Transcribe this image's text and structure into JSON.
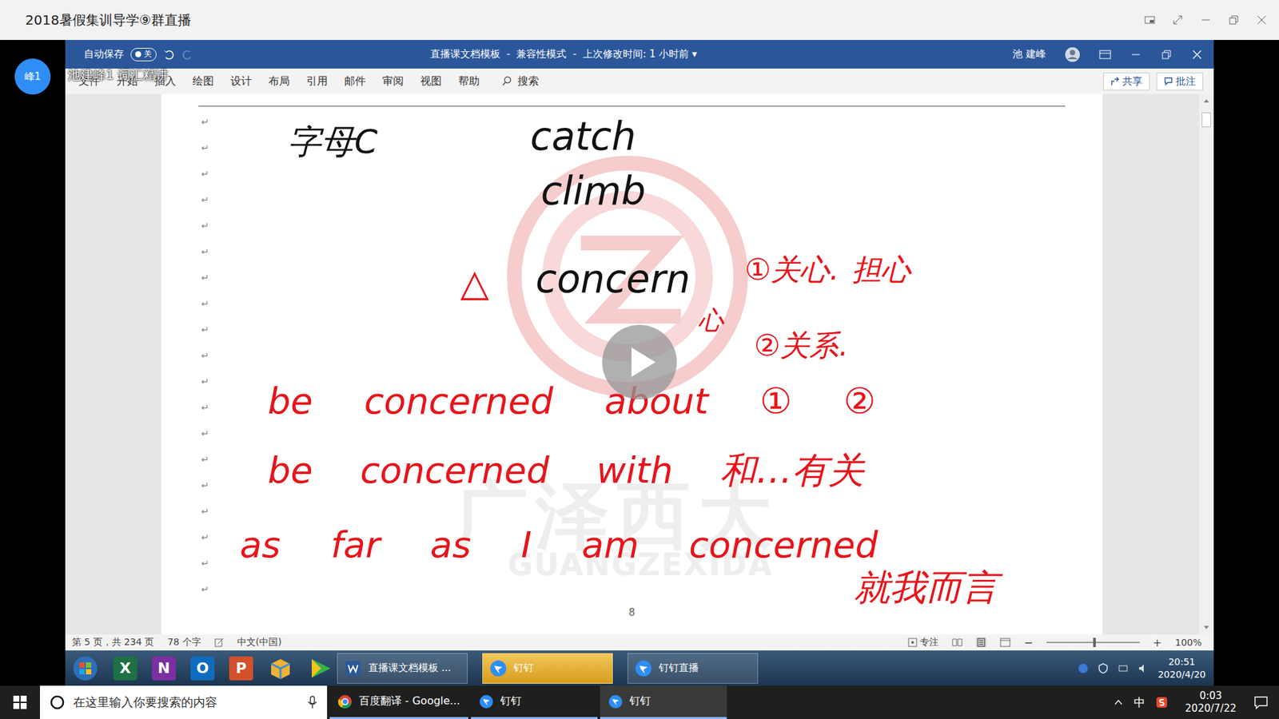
{
  "window": {
    "title": "2018暑假集训导学⑨群直播"
  },
  "presenter": {
    "avatar": "峰1",
    "caption": "池建峰1 词汇精讲"
  },
  "word": {
    "autosave": {
      "label": "自动保存",
      "state": "关",
      "on": false
    },
    "title": "直播课文档模板  -  兼容性模式  -  上次修改时间: 1 小时前 ▾",
    "user": "池 建峰",
    "tabs": [
      {
        "label": "文件",
        "selected": false
      },
      {
        "label": "开始",
        "selected": false
      },
      {
        "label": "插入",
        "selected": false
      },
      {
        "label": "绘图",
        "selected": false
      },
      {
        "label": "设计",
        "selected": false
      },
      {
        "label": "布局",
        "selected": false
      },
      {
        "label": "引用",
        "selected": false
      },
      {
        "label": "邮件",
        "selected": false
      },
      {
        "label": "审阅",
        "selected": false
      },
      {
        "label": "视图",
        "selected": false
      },
      {
        "label": "帮助",
        "selected": false
      }
    ],
    "search": "搜索",
    "share": "共享",
    "comment": "批注"
  },
  "document": {
    "paragraph_marks": [
      "↵",
      "↵",
      "↵",
      "↵",
      "↵",
      "↵",
      "↵",
      "↵",
      "↵",
      "↵",
      "↵",
      "↵",
      "↵",
      "↵",
      "↵",
      "↵",
      "↵",
      "↵",
      "↵"
    ],
    "handwriting": [
      {
        "text": "字母C",
        "color": "#111111"
      },
      {
        "text": "catch",
        "color": "#111111"
      },
      {
        "text": "climb",
        "color": "#111111"
      },
      {
        "text": "△",
        "color": "#e8141b"
      },
      {
        "text": "concern",
        "color": "#111111"
      },
      {
        "text": "①关心. 担心",
        "color": "#e8141b"
      },
      {
        "text": "心",
        "color": "#e8141b"
      },
      {
        "text": "②关系.",
        "color": "#e8141b"
      },
      {
        "text": "be concerned about ① ②",
        "color": "#e8141b"
      },
      {
        "text": "be concerned with 和…有关",
        "color": "#e8141b"
      },
      {
        "text": "as far as I am concerned",
        "color": "#e8141b"
      },
      {
        "text": "就我而言",
        "color": "#e8141b"
      }
    ],
    "watermark": {
      "cn": "广泽西大",
      "en": "GUANGZEXIDA"
    },
    "page_number": "8"
  },
  "status_bar": {
    "page": "第 5 页，共 234 页",
    "words": "78 个字",
    "language": "中文(中国)",
    "focus": "专注",
    "zoom": "100%",
    "zoom_level": 0.5
  },
  "inner_taskbar": {
    "pinned": [
      {
        "glyph": "X",
        "color": "#1d7044"
      },
      {
        "glyph": "N",
        "color": "#7b2fa0"
      },
      {
        "glyph": "O",
        "color": "#0f6cbd"
      },
      {
        "glyph": "P",
        "color": "#d2502b"
      }
    ],
    "apps": [
      {
        "label": "直播课文档模板 ...",
        "selected": false
      },
      {
        "label": "钉钉",
        "selected": true
      },
      {
        "label": "钉钉直播",
        "selected": false
      }
    ],
    "time": "20:51",
    "date": "2020/4/20"
  },
  "taskbar": {
    "search": "在这里输入你要搜索的内容",
    "apps": [
      {
        "label": "百度翻译 - Google...",
        "selected": false
      },
      {
        "label": "钉钉",
        "selected": false
      },
      {
        "label": "钉钉",
        "selected": true
      }
    ],
    "ime": "中",
    "time": "0:03",
    "date": "2020/7/22"
  }
}
